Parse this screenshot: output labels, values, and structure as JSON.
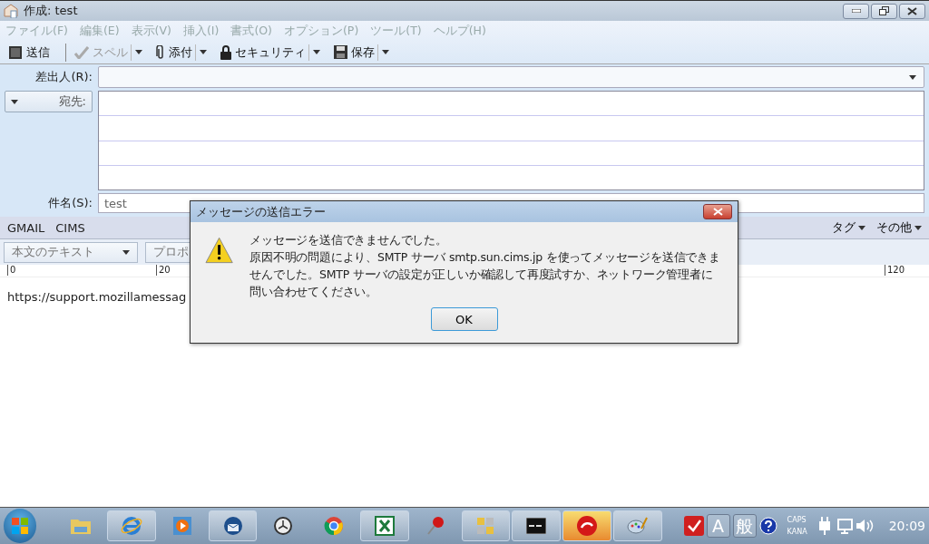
{
  "window": {
    "title": "作成: test"
  },
  "menu": [
    {
      "label": "ファイル(F)",
      "disabled": true
    },
    {
      "label": "編集(E)",
      "disabled": true
    },
    {
      "label": "表示(V)",
      "disabled": true
    },
    {
      "label": "挿入(I)",
      "disabled": true
    },
    {
      "label": "書式(O)",
      "disabled": true
    },
    {
      "label": "オプション(P)",
      "disabled": true
    },
    {
      "label": "ツール(T)",
      "disabled": true
    },
    {
      "label": "ヘルプ(H)",
      "disabled": true
    }
  ],
  "toolbar": [
    {
      "kind": "send",
      "label": "送信",
      "disabled": false,
      "dropdown": false
    },
    {
      "kind": "spell",
      "label": "スペル",
      "disabled": true,
      "dropdown": true
    },
    {
      "kind": "attach",
      "label": "添付",
      "disabled": false,
      "dropdown": true
    },
    {
      "kind": "security",
      "label": "セキュリティ",
      "disabled": false,
      "dropdown": true
    },
    {
      "kind": "save",
      "label": "保存",
      "disabled": false,
      "dropdown": true
    }
  ],
  "headers": {
    "from_label": "差出人(R):",
    "to_label": "宛先:",
    "subject_label": "件名(S):",
    "subject_value": "test"
  },
  "identity_bar": {
    "left": [
      "GMAIL",
      "CIMS"
    ],
    "right": [
      "タグ",
      "その他"
    ]
  },
  "format_bar": {
    "paragraph_style": "本文のテキスト",
    "font": "プロポ"
  },
  "ruler": {
    "labels": [
      "0",
      "20",
      "120"
    ]
  },
  "body": {
    "text": "https://support.mozillamessag"
  },
  "dialog": {
    "title": "メッセージの送信エラー",
    "message": "メッセージを送信できませんでした。",
    "detail": "原因不明の問題により、SMTP サーバ smtp.sun.cims.jp を使ってメッセージを送信できませんでした。SMTP サーバの設定が正しいか確認して再度試すか、ネットワーク管理者に問い合わせてください。",
    "button": "OK"
  },
  "taskbar": {
    "apps": [
      {
        "kind": "folder",
        "open": false,
        "selected": false
      },
      {
        "kind": "browser-e",
        "open": true,
        "selected": false
      },
      {
        "kind": "media",
        "open": false,
        "selected": false
      },
      {
        "kind": "mail",
        "open": true,
        "selected": false
      },
      {
        "kind": "clock",
        "open": false,
        "selected": false
      },
      {
        "kind": "globe",
        "open": false,
        "selected": false
      },
      {
        "kind": "sheet",
        "open": true,
        "selected": false
      },
      {
        "kind": "pin",
        "open": false,
        "selected": false
      },
      {
        "kind": "network",
        "open": true,
        "selected": false
      },
      {
        "kind": "console",
        "open": true,
        "selected": false
      },
      {
        "kind": "swirl",
        "open": true,
        "selected": true
      },
      {
        "kind": "palette",
        "open": true,
        "selected": false
      }
    ],
    "ime": [
      "A",
      "般"
    ],
    "caps": "CAPS",
    "kana": "KANA",
    "clock": "20:09"
  }
}
